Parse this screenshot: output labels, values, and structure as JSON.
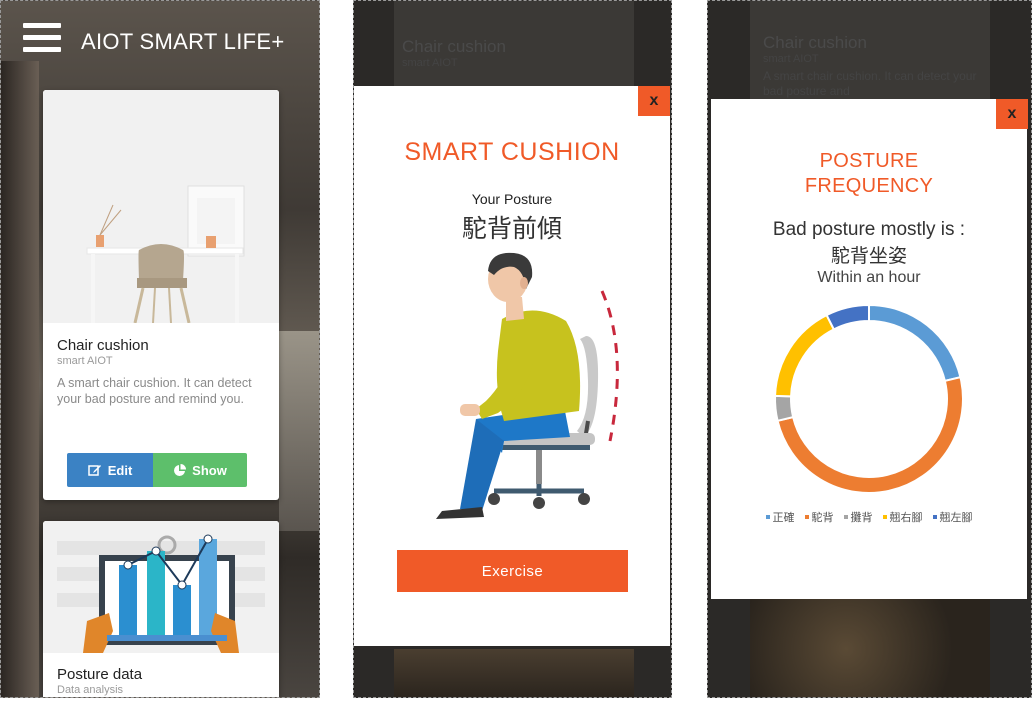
{
  "screen1": {
    "app_title": "AIOT SMART LIFE+",
    "card1": {
      "title": "Chair cushion",
      "subtitle": "smart AIOT",
      "description": "A smart chair cushion. It can detect your bad posture and remind you.",
      "edit_label": "Edit",
      "show_label": "Show"
    },
    "card2": {
      "title": "Posture data",
      "subtitle": "Data analysis"
    }
  },
  "screen2": {
    "bg_title": "Chair cushion",
    "bg_subtitle": "smart AIOT",
    "title": "SMART CUSHION",
    "posture_label": "Your Posture",
    "posture_value": "駝背前傾",
    "exercise_label": "Exercise",
    "close_label": "x"
  },
  "screen3": {
    "bg_title": "Chair cushion",
    "bg_subtitle": "smart AIOT",
    "bg_desc": "A smart chair cushion. It can detect your bad posture and",
    "title_line1": "POSTURE",
    "title_line2": "FREQUENCY",
    "bad_label": "Bad posture mostly is :",
    "bad_value": "駝背坐姿",
    "within": "Within an hour",
    "close_label": "x",
    "legend": [
      {
        "label": "正確",
        "color": "#5b9bd5"
      },
      {
        "label": "駝背",
        "color": "#ed7d31"
      },
      {
        "label": "攤背",
        "color": "#a5a5a5"
      },
      {
        "label": "翹右腳",
        "color": "#ffc000"
      },
      {
        "label": "翹左腳",
        "color": "#4472c4"
      }
    ]
  },
  "chart_data": {
    "type": "pie",
    "title": "",
    "categories": [
      "正確",
      "駝背",
      "攤背",
      "翹右腳",
      "翹左腳"
    ],
    "values": [
      20,
      47,
      4,
      16,
      7
    ],
    "colors": [
      "#5b9bd5",
      "#ed7d31",
      "#a5a5a5",
      "#ffc000",
      "#4472c4"
    ],
    "legend_position": "bottom"
  }
}
